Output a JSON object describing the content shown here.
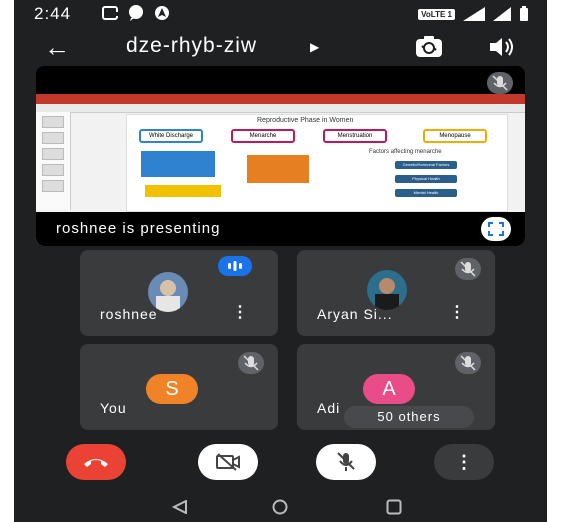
{
  "status_bar": {
    "time": "2:44",
    "network_label": "VoLTE 1"
  },
  "app_bar": {
    "meeting_code": "dze-rhyb-ziw"
  },
  "presentation": {
    "caption": "roshnee is presenting",
    "slide": {
      "title": "Reproductive Phase in Women",
      "boxes": [
        "White Discharge",
        "Menarche",
        "Menstruation",
        "Menopause"
      ],
      "factors_title": "Factors affecting menarche",
      "factors": [
        "Genetic/Hormonal Factors",
        "Physical Health",
        "Mental Health"
      ]
    }
  },
  "participants": [
    {
      "name": "roshnee",
      "status": "speaking"
    },
    {
      "name": "Aryan Si...",
      "status": "muted"
    },
    {
      "name": "You",
      "initial": "S",
      "color": "#f08327",
      "status": "muted"
    },
    {
      "name": "Adi",
      "initial": "A",
      "color": "#ea4c89",
      "status": "muted"
    }
  ],
  "others_label": "50 others",
  "colors": {
    "background": "#1f2022",
    "tile": "#3a3b3d",
    "end_call": "#ea4335",
    "speaking_badge": "#1a73e8"
  }
}
